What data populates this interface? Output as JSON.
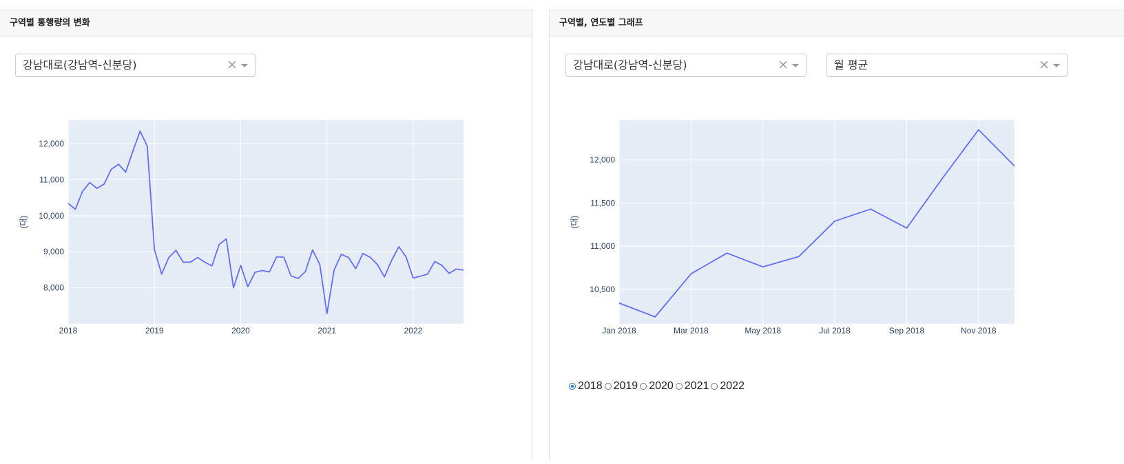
{
  "left_panel": {
    "header": "구역별 통행량의 변화",
    "dropdown": {
      "value": "강남대로(강남역-신분당)",
      "clear_glyph": "×"
    }
  },
  "right_panel": {
    "header": "구역별, 연도별 그래프",
    "dropdown_area": {
      "value": "강남대로(강남역-신분당)",
      "clear_glyph": "×"
    },
    "dropdown_stat": {
      "value": "월 평균",
      "clear_glyph": "×"
    },
    "year_options": [
      "2018",
      "2019",
      "2020",
      "2021",
      "2022"
    ],
    "selected_year": "2018"
  },
  "colors": {
    "line": "#636efa",
    "plot_bg": "#e5ecf6",
    "grid": "#ffffff",
    "tick_text": "#2a3f5f"
  },
  "chart_data": [
    {
      "type": "line",
      "ylabel": "(대)",
      "xlabel": "",
      "x_ticks": [
        "2018",
        "2019",
        "2020",
        "2021",
        "2022"
      ],
      "y_ticks": [
        8000,
        9000,
        10000,
        11000,
        12000
      ],
      "y_tick_labels": [
        "8,000",
        "9,000",
        "10,000",
        "11,000",
        "12,000"
      ],
      "ylim": [
        7000,
        12650
      ],
      "xlim": [
        "2018-01",
        "2022-08"
      ],
      "grid": true,
      "x": [
        "2018-01",
        "2018-02",
        "2018-03",
        "2018-04",
        "2018-05",
        "2018-06",
        "2018-07",
        "2018-08",
        "2018-09",
        "2018-10",
        "2018-11",
        "2018-12",
        "2019-01",
        "2019-02",
        "2019-03",
        "2019-04",
        "2019-05",
        "2019-06",
        "2019-07",
        "2019-08",
        "2019-09",
        "2019-10",
        "2019-11",
        "2019-12",
        "2020-01",
        "2020-02",
        "2020-03",
        "2020-04",
        "2020-05",
        "2020-06",
        "2020-07",
        "2020-08",
        "2020-09",
        "2020-10",
        "2020-11",
        "2020-12",
        "2021-01",
        "2021-02",
        "2021-03",
        "2021-04",
        "2021-05",
        "2021-06",
        "2021-07",
        "2021-08",
        "2021-09",
        "2021-10",
        "2021-11",
        "2021-12",
        "2022-01",
        "2022-02",
        "2022-03",
        "2022-04",
        "2022-05",
        "2022-06",
        "2022-07",
        "2022-08"
      ],
      "values": [
        10340,
        10180,
        10680,
        10920,
        10760,
        10880,
        11290,
        11430,
        11210,
        11790,
        12350,
        11930,
        9060,
        8380,
        8840,
        9040,
        8710,
        8710,
        8840,
        8710,
        8610,
        9200,
        9360,
        8000,
        8620,
        8030,
        8430,
        8480,
        8440,
        8860,
        8850,
        8330,
        8260,
        8450,
        9050,
        8650,
        7280,
        8490,
        8930,
        8840,
        8530,
        8950,
        8850,
        8650,
        8300,
        8760,
        9140,
        8860,
        8270,
        8320,
        8380,
        8730,
        8620,
        8400,
        8520,
        8490
      ]
    },
    {
      "type": "line",
      "ylabel": "(대)",
      "xlabel": "",
      "x_ticks": [
        "Jan 2018",
        "Mar 2018",
        "May 2018",
        "Jul 2018",
        "Sep 2018",
        "Nov 2018"
      ],
      "y_ticks": [
        10500,
        11000,
        11500,
        12000
      ],
      "y_tick_labels": [
        "10,500",
        "11,000",
        "11,500",
        "12,000"
      ],
      "ylim": [
        10100,
        12460
      ],
      "xlim": [
        "2018-01",
        "2018-12"
      ],
      "grid": true,
      "x": [
        "2018-01",
        "2018-02",
        "2018-03",
        "2018-04",
        "2018-05",
        "2018-06",
        "2018-07",
        "2018-08",
        "2018-09",
        "2018-10",
        "2018-11",
        "2018-12"
      ],
      "values": [
        10340,
        10180,
        10680,
        10920,
        10760,
        10880,
        11290,
        11430,
        11210,
        11790,
        12350,
        11930
      ]
    }
  ]
}
